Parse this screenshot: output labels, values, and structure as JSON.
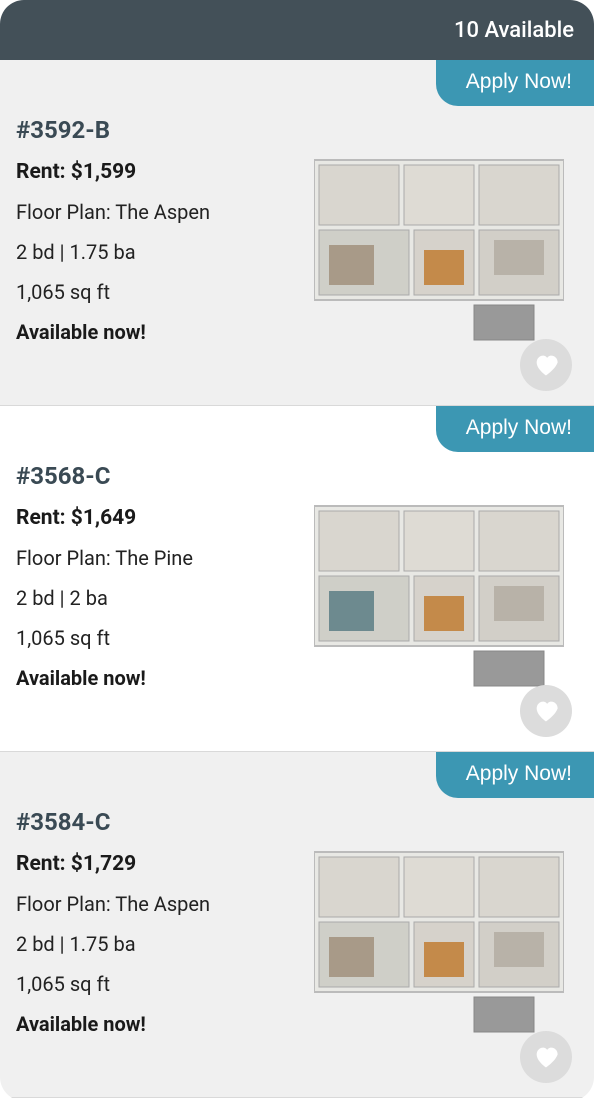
{
  "header": {
    "available_text": "10 Available"
  },
  "apply_label": "Apply Now!",
  "listings": [
    {
      "unit_id": "#3592-B",
      "rent": "Rent: $1,599",
      "floor_plan": "Floor Plan: The Aspen",
      "beds_baths": "2 bd  |  1.75 ba",
      "sqft": "1,065 sq ft",
      "availability": "Available now!"
    },
    {
      "unit_id": "#3568-C",
      "rent": "Rent: $1,649",
      "floor_plan": "Floor Plan: The Pine",
      "beds_baths": "2 bd  |  2 ba",
      "sqft": "1,065 sq ft",
      "availability": "Available now!"
    },
    {
      "unit_id": "#3584-C",
      "rent": "Rent: $1,729",
      "floor_plan": "Floor Plan: The Aspen",
      "beds_baths": "2 bd  |  1.75 ba",
      "sqft": "1,065 sq ft",
      "availability": "Available now!"
    }
  ]
}
